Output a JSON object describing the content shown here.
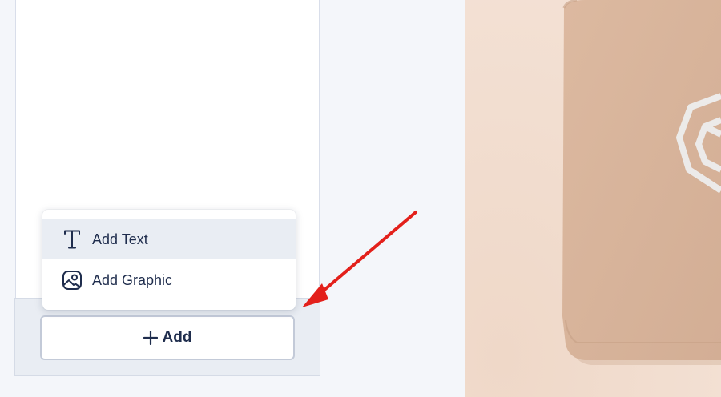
{
  "editor": {
    "add_menu": {
      "items": [
        {
          "label": "Add Text",
          "icon": "text-tool-icon"
        },
        {
          "label": "Add Graphic",
          "icon": "image-icon"
        }
      ]
    },
    "add_button": {
      "label": "Add",
      "icon": "plus-icon"
    }
  },
  "preview": {
    "background": "#f2dfd1",
    "bag_color": "#d8b49c",
    "logo_color": "#eeeeee"
  },
  "annotation": {
    "arrow_color": "#e3201b"
  },
  "colors": {
    "text": "#1f2d4d",
    "menu_hover": "#e9edf3",
    "panel_bg": "#f4f6fa"
  }
}
